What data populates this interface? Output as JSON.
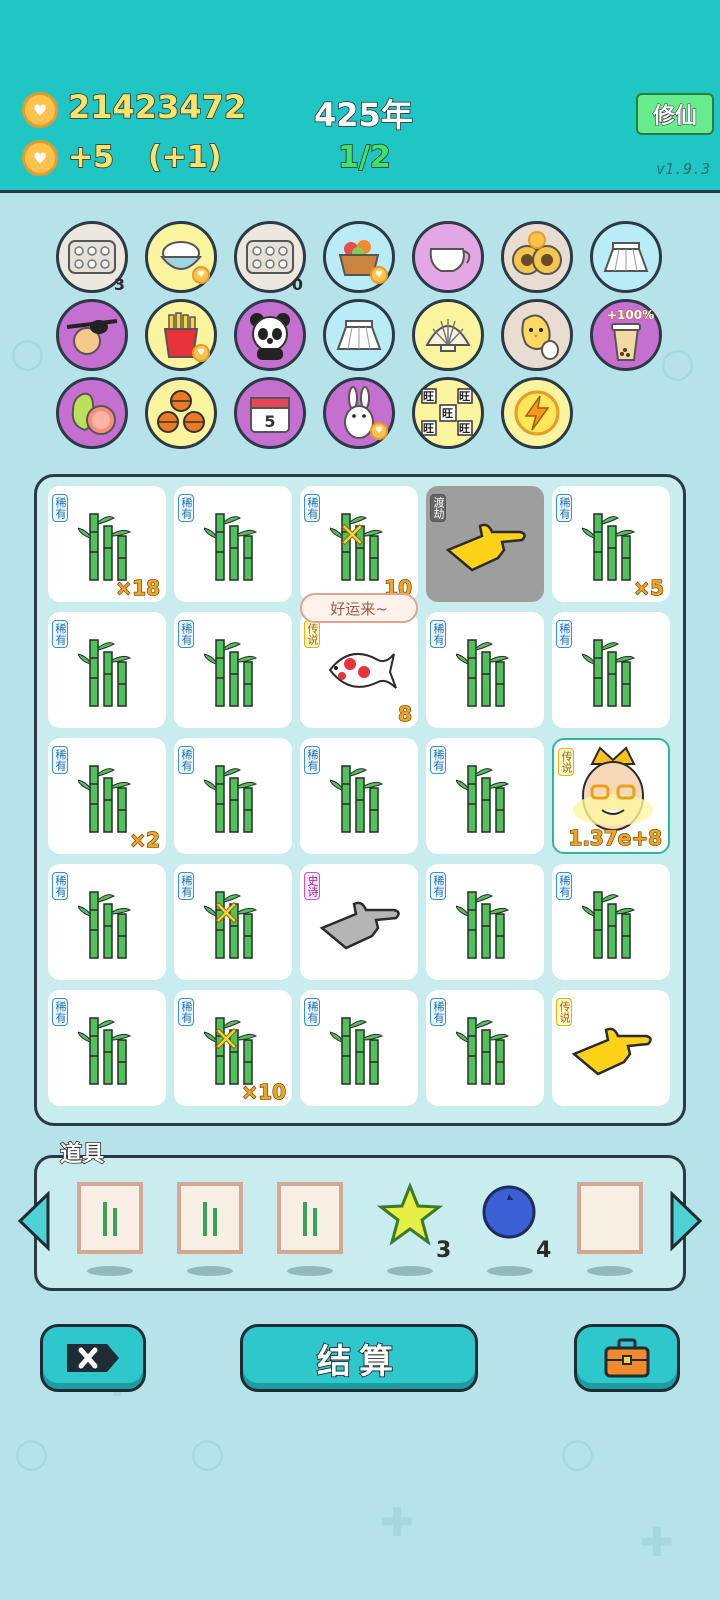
{
  "header": {
    "coins": "21423472",
    "income": "+5",
    "income_bonus": "(+1)",
    "year": "425年",
    "progress": "1/2",
    "xiuxian_button": "修仙",
    "version": "v1.9.3"
  },
  "inventory": [
    {
      "name": "egg-tray-icon",
      "count": "3"
    },
    {
      "name": "rice-bowl-icon"
    },
    {
      "name": "egg-tray-icon",
      "count": "0"
    },
    {
      "name": "fruit-basket-icon"
    },
    {
      "name": "milk-jug-icon"
    },
    {
      "name": "owl-icon"
    },
    {
      "name": "skirt-icon"
    },
    {
      "name": "eyepatch-icon"
    },
    {
      "name": "fries-icon"
    },
    {
      "name": "panda-icon"
    },
    {
      "name": "skirt-icon"
    },
    {
      "name": "shell-icon"
    },
    {
      "name": "chick-egg-icon"
    },
    {
      "name": "bubble-tea-icon",
      "tag": "+100%"
    },
    {
      "name": "grapefruit-icon"
    },
    {
      "name": "basketballs-icon"
    },
    {
      "name": "calendar-icon",
      "label": "5"
    },
    {
      "name": "rabbit-icon"
    },
    {
      "name": "wang-tiles-icon",
      "label": "旺"
    },
    {
      "name": "lightning-icon"
    }
  ],
  "board": {
    "speech": "好运来~",
    "cells": [
      {
        "rarity": "稀有",
        "item": "bamboo",
        "count": "×18"
      },
      {
        "rarity": "稀有",
        "item": "bamboo",
        "count": ""
      },
      {
        "rarity": "稀有",
        "item": "bamboo-sparkle",
        "count": "10"
      },
      {
        "rarity": "渡劫",
        "item": "hand-point-gold",
        "count": ""
      },
      {
        "rarity": "稀有",
        "item": "bamboo",
        "count": "×5"
      },
      {
        "rarity": "稀有",
        "item": "bamboo",
        "count": ""
      },
      {
        "rarity": "稀有",
        "item": "bamboo",
        "count": ""
      },
      {
        "rarity": "传说",
        "item": "koi-fish",
        "count": "8"
      },
      {
        "rarity": "稀有",
        "item": "bamboo",
        "count": ""
      },
      {
        "rarity": "稀有",
        "item": "bamboo",
        "count": ""
      },
      {
        "rarity": "稀有",
        "item": "bamboo",
        "count": "×2"
      },
      {
        "rarity": "稀有",
        "item": "bamboo",
        "count": ""
      },
      {
        "rarity": "稀有",
        "item": "bamboo",
        "count": ""
      },
      {
        "rarity": "稀有",
        "item": "bamboo",
        "count": ""
      },
      {
        "rarity": "传说",
        "item": "king-face",
        "count": "1.37e+8"
      },
      {
        "rarity": "稀有",
        "item": "bamboo",
        "count": ""
      },
      {
        "rarity": "稀有",
        "item": "bamboo-sparkle",
        "count": ""
      },
      {
        "rarity": "史诗",
        "item": "hand-point-grey",
        "count": ""
      },
      {
        "rarity": "稀有",
        "item": "bamboo",
        "count": ""
      },
      {
        "rarity": "稀有",
        "item": "bamboo",
        "count": ""
      },
      {
        "rarity": "稀有",
        "item": "bamboo",
        "count": ""
      },
      {
        "rarity": "稀有",
        "item": "bamboo-sparkle",
        "count": "×10"
      },
      {
        "rarity": "稀有",
        "item": "bamboo",
        "count": ""
      },
      {
        "rarity": "稀有",
        "item": "bamboo",
        "count": ""
      },
      {
        "rarity": "传说",
        "item": "hand-point-gold",
        "count": ""
      }
    ]
  },
  "tools": {
    "title": "道具",
    "items": [
      {
        "name": "bamboo-frame-icon",
        "count": ""
      },
      {
        "name": "bamboo-frame-icon",
        "count": ""
      },
      {
        "name": "bamboo-frame-icon",
        "count": ""
      },
      {
        "name": "star-icon",
        "count": "3"
      },
      {
        "name": "blueberry-icon",
        "count": "4"
      },
      {
        "name": "empty-frame-icon",
        "count": ""
      }
    ]
  },
  "buttons": {
    "settle": "结算"
  }
}
